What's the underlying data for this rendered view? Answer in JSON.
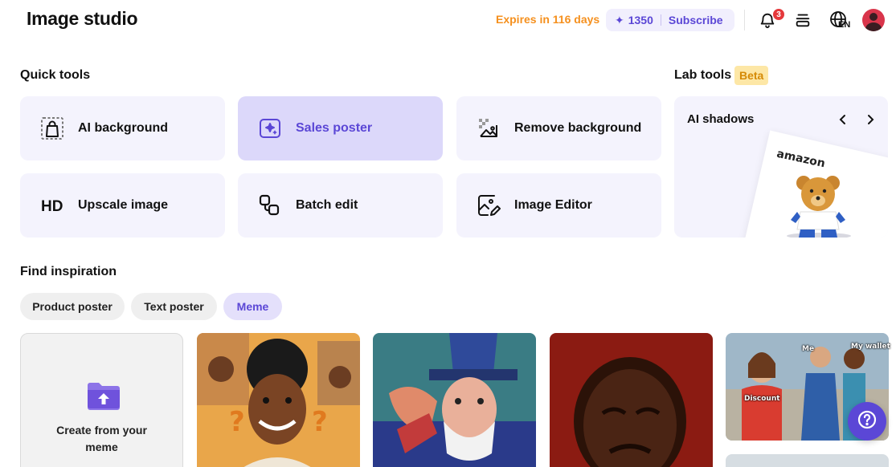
{
  "header": {
    "title": "Image studio",
    "expires": "Expires in 116 days",
    "credits": "1350",
    "subscribe": "Subscribe",
    "notification_count": "3",
    "language": "EN"
  },
  "quick_tools": {
    "title": "Quick tools",
    "items": [
      {
        "label": "AI background",
        "icon": "bag-icon"
      },
      {
        "label": "Sales poster",
        "icon": "sparkle-image-icon"
      },
      {
        "label": "Remove background",
        "icon": "remove-bg-icon"
      },
      {
        "label": "Upscale image",
        "icon": "hd-icon"
      },
      {
        "label": "Batch edit",
        "icon": "batch-icon"
      },
      {
        "label": "Image Editor",
        "icon": "image-edit-icon"
      }
    ]
  },
  "lab_tools": {
    "title": "Lab tools",
    "badge": "Beta",
    "card_title": "AI shadows",
    "image_brand": "amazon"
  },
  "inspiration": {
    "title": "Find inspiration",
    "chips": [
      "Product poster",
      "Text poster",
      "Meme"
    ],
    "active_chip": "Meme",
    "create_label": "Create from your meme",
    "meme_captions": [
      "Me",
      "My wallet",
      "Discount"
    ],
    "colors": {
      "accent": "#5b47d6",
      "orange": "#f5901e",
      "card_bg": "#f4f3fd"
    }
  }
}
